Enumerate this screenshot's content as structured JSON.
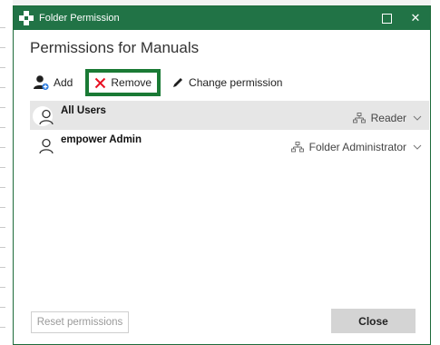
{
  "window": {
    "title": "Folder Permission",
    "maximize_icon": "maximize-icon",
    "close_glyph": "✕"
  },
  "heading": "Permissions for Manuals",
  "toolbar": {
    "add_label": "Add",
    "remove_label": "Remove",
    "change_label": "Change permission",
    "remove_color": "#e81123",
    "highlight_color": "#1a7a35"
  },
  "users": [
    {
      "name": "All Users",
      "role": "Reader",
      "selected": true
    },
    {
      "name": "empower Admin",
      "role": "Folder Administrator",
      "selected": false
    }
  ],
  "buttons": {
    "reset_label": "Reset permissions",
    "close_label": "Close"
  },
  "colors": {
    "titlebar": "#217346",
    "selected_row": "#e6e6e6"
  }
}
